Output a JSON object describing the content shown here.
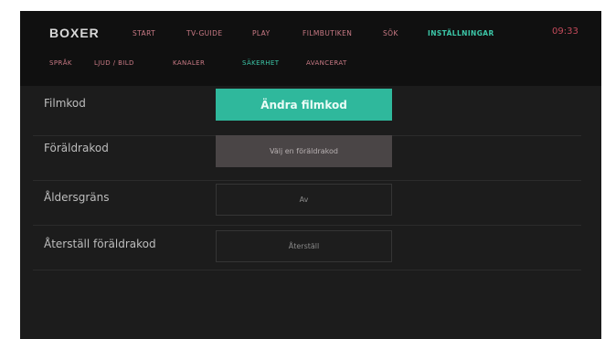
{
  "header": {
    "brand": "BOXER",
    "nav": [
      "START",
      "TV-GUIDE",
      "PLAY",
      "FILMBUTIKEN",
      "SÖK",
      "INSTÄLLNINGAR"
    ],
    "active_nav": "INSTÄLLNINGAR",
    "clock": "09:33"
  },
  "subnav": {
    "items": [
      "SPRÅK",
      "LJUD / BILD",
      "KANALER",
      "SÄKERHET",
      "AVANCERAT"
    ],
    "active": "SÄKERHET"
  },
  "settings": [
    {
      "label": "Filmkod",
      "button": "Ändra filmkod"
    },
    {
      "label": "Föräldrakod",
      "button": "Välj en föräldrakod"
    },
    {
      "label": "Åldersgräns",
      "button": "Av"
    },
    {
      "label": "Återställ föräldrakod",
      "button": "Återställ"
    }
  ],
  "colors": {
    "accent": "#2fb89c",
    "nav_text": "#c97a85",
    "clock": "#c24a5a",
    "background": "#1c1c1c"
  }
}
